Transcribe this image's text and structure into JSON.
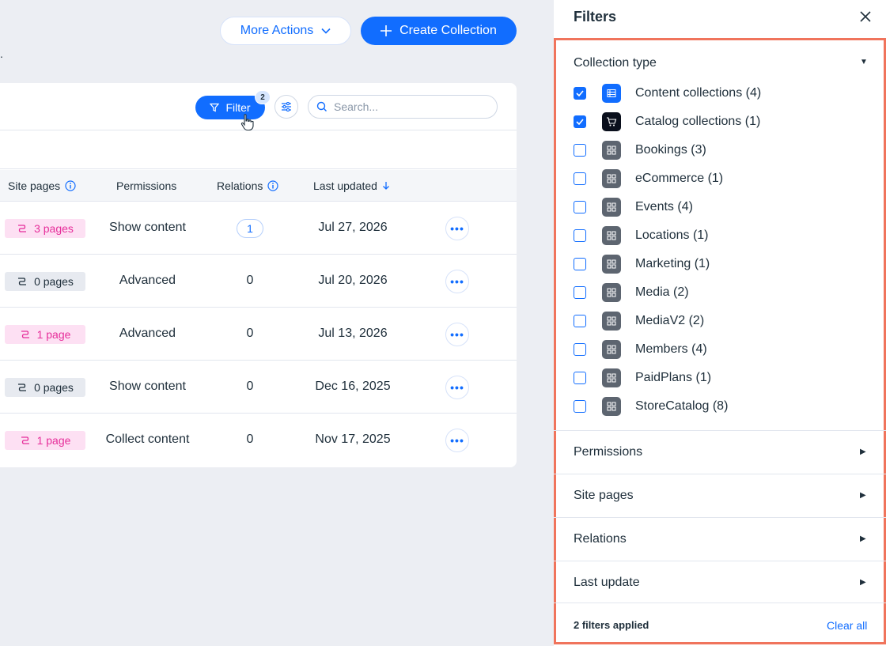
{
  "header": {
    "more_actions_label": "More Actions",
    "create_label": "Create Collection",
    "stray_text": "."
  },
  "toolbar": {
    "filter_label": "Filter",
    "filter_count": "2",
    "search_placeholder": "Search..."
  },
  "table": {
    "columns": {
      "site_pages": "Site pages",
      "permissions": "Permissions",
      "relations": "Relations",
      "last_updated": "Last updated"
    },
    "rows": [
      {
        "pages": "3 pages",
        "pages_style": "pink",
        "permissions": "Show content",
        "relations": "1",
        "relations_pill": true,
        "updated": "Jul 27, 2026"
      },
      {
        "pages": "0 pages",
        "pages_style": "grey",
        "permissions": "Advanced",
        "relations": "0",
        "relations_pill": false,
        "updated": "Jul 20, 2026"
      },
      {
        "pages": "1 page",
        "pages_style": "pink",
        "permissions": "Advanced",
        "relations": "0",
        "relations_pill": false,
        "updated": "Jul 13, 2026"
      },
      {
        "pages": "0 pages",
        "pages_style": "grey",
        "permissions": "Show content",
        "relations": "0",
        "relations_pill": false,
        "updated": "Dec 16, 2025"
      },
      {
        "pages": "1 page",
        "pages_style": "pink",
        "permissions": "Collect content",
        "relations": "0",
        "relations_pill": false,
        "updated": "Nov 17, 2025"
      }
    ]
  },
  "filters": {
    "title": "Filters",
    "collection_type": {
      "label": "Collection type",
      "options": [
        {
          "label": "Content collections (4)",
          "checked": true,
          "icon": "table-icon",
          "icon_style": "blue"
        },
        {
          "label": "Catalog collections (1)",
          "checked": true,
          "icon": "cart-icon",
          "icon_style": "black"
        },
        {
          "label": "Bookings (3)",
          "checked": false,
          "icon": "app-icon",
          "icon_style": "grey"
        },
        {
          "label": "eCommerce (1)",
          "checked": false,
          "icon": "app-icon",
          "icon_style": "grey"
        },
        {
          "label": "Events (4)",
          "checked": false,
          "icon": "app-icon",
          "icon_style": "grey"
        },
        {
          "label": "Locations (1)",
          "checked": false,
          "icon": "app-icon",
          "icon_style": "grey"
        },
        {
          "label": "Marketing (1)",
          "checked": false,
          "icon": "app-icon",
          "icon_style": "grey"
        },
        {
          "label": "Media (2)",
          "checked": false,
          "icon": "app-icon",
          "icon_style": "grey"
        },
        {
          "label": "MediaV2 (2)",
          "checked": false,
          "icon": "app-icon",
          "icon_style": "grey"
        },
        {
          "label": "Members (4)",
          "checked": false,
          "icon": "app-icon",
          "icon_style": "grey"
        },
        {
          "label": "PaidPlans (1)",
          "checked": false,
          "icon": "app-icon",
          "icon_style": "grey"
        },
        {
          "label": "StoreCatalog (8)",
          "checked": false,
          "icon": "app-icon",
          "icon_style": "grey"
        }
      ]
    },
    "sections": [
      "Permissions",
      "Site pages",
      "Relations",
      "Last update"
    ],
    "applied_text": "2 filters applied",
    "clear_all": "Clear all"
  },
  "colors": {
    "accent": "#116dff",
    "highlight_border": "#f0745c",
    "pink_badge": "#fde0f3"
  }
}
